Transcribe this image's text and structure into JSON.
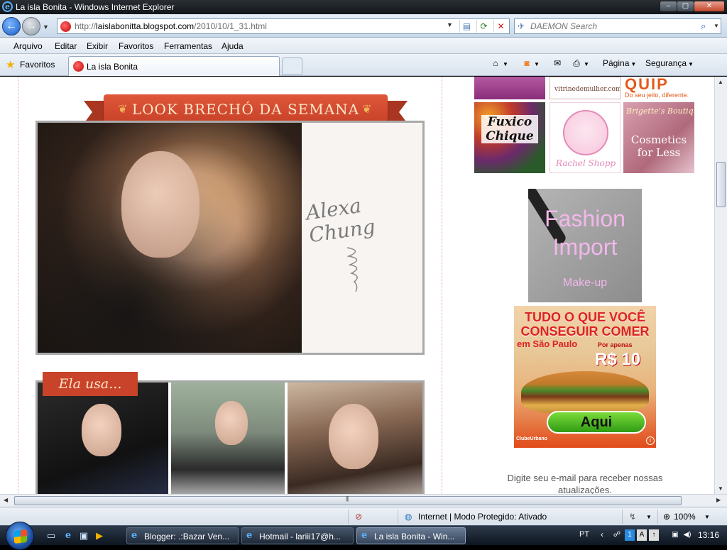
{
  "window": {
    "title": "La isla Bonita - Windows Internet Explorer",
    "minimize_glyph": "–",
    "maximize_glyph": "▢",
    "close_glyph": "✕"
  },
  "address": {
    "url_prefix": "http://",
    "url_host": "laislabonitta.blogspot.com",
    "url_path": "/2010/10/1_31.html",
    "search_placeholder": "DAEMON Search"
  },
  "menu": {
    "items": [
      "Arquivo",
      "Editar",
      "Exibir",
      "Favoritos",
      "Ferramentas",
      "Ajuda"
    ]
  },
  "favbar": {
    "favorites_label": "Favoritos",
    "active_tab": "La isla Bonita",
    "commands": {
      "page": "Página",
      "security": "Segurança"
    }
  },
  "content": {
    "banner_title": "LOOK BRECHÓ DA SEMANA",
    "hero_signature": "Alexa\nChung",
    "ela_tag": "Ela usa..."
  },
  "sidebar": {
    "top_middle_ad": "vitrinedemulher.com.br",
    "top_right_ad_logo": "QUIP",
    "top_right_ad_tagline": "Do seu jeito, diferente.",
    "fuxico_ad": "Fuxico Chique",
    "rachel_ad": "Rachel Shopp",
    "brigette_title": "Brigette's Boutique",
    "brigette_text": "Cosmetics for Less",
    "fashion_title": "Fashion Import",
    "fashion_sub": "Make-up",
    "clube": {
      "headline": "TUDO O QUE VOCÊ CONSEGUIR COMER",
      "city": "em São Paulo",
      "price_prefix": "Por apenas",
      "price": "R$ 10",
      "button": "Aqui",
      "brand": "ClubeUrbano",
      "info_glyph": "i"
    },
    "newsletter": "Digite seu e-mail para receber nossas atualizações."
  },
  "status": {
    "zone": "Internet | Modo Protegido: Ativado",
    "zoom": "100%"
  },
  "taskbar": {
    "tasks": [
      {
        "label": "Blogger: .:Bazar Ven..."
      },
      {
        "label": "Hotmail - lariii17@h..."
      },
      {
        "label": "La isla Bonita - Win..."
      }
    ],
    "language": "PT",
    "clock": "13:16"
  },
  "colors": {
    "accent_red": "#c9432a",
    "titlebar": "#12161a",
    "link_blue": "#1d5ec9"
  }
}
